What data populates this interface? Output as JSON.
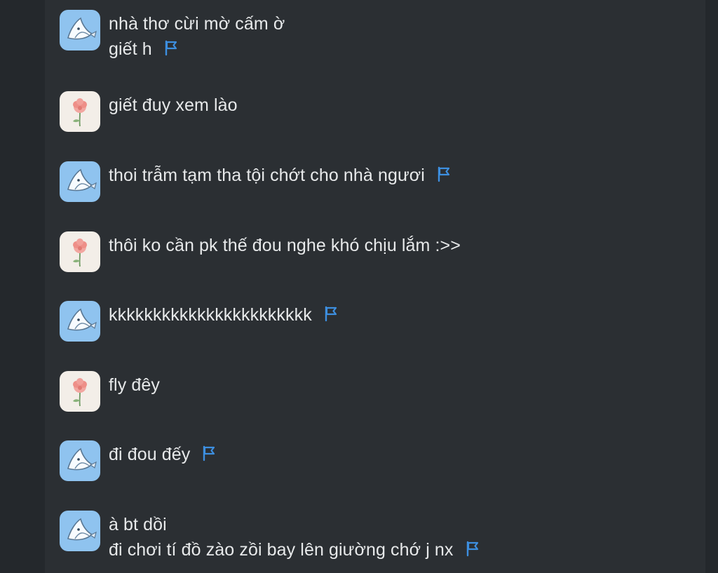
{
  "colors": {
    "background": "#2b2f33",
    "text": "#e7e9ea",
    "flag": "#3d8fe0",
    "avatar_whale_bg": "#8fc3ef",
    "avatar_flower_bg": "#f3eee8"
  },
  "messages": [
    {
      "avatar": "whale-avatar",
      "lines": [
        "nhà thơ cừi mờ cấm ờ",
        "giết h"
      ],
      "flag": true
    },
    {
      "avatar": "flower-avatar",
      "lines": [
        "giết đuy xem lào"
      ],
      "flag": false
    },
    {
      "avatar": "whale-avatar",
      "lines": [
        "thoi trẫm tạm tha tội chớt cho nhà ngươi"
      ],
      "flag": true
    },
    {
      "avatar": "flower-avatar",
      "lines": [
        "thôi ko cần pk thế đou nghe khó chịu lắm :>>"
      ],
      "flag": false
    },
    {
      "avatar": "whale-avatar",
      "lines": [
        "kkkkkkkkkkkkkkkkkkkkkkk"
      ],
      "flag": true
    },
    {
      "avatar": "flower-avatar",
      "lines": [
        "fly đêy"
      ],
      "flag": false
    },
    {
      "avatar": "whale-avatar",
      "lines": [
        "đi đou đếy"
      ],
      "flag": true
    },
    {
      "avatar": "whale-avatar",
      "lines": [
        "à bt dồi",
        "đi chơi tí đồ zào zồi bay lên giường chớ j nx"
      ],
      "flag": true
    }
  ]
}
